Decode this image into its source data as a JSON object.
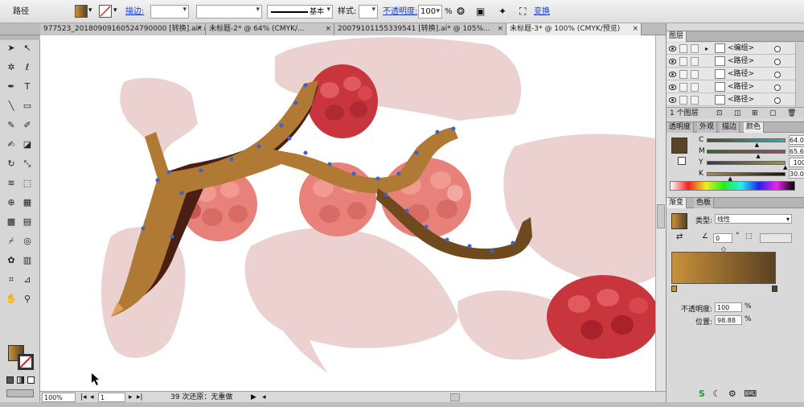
{
  "control_bar": {
    "object_type": "路径",
    "stroke_label": "描边:",
    "stroke_weight": "",
    "stroke_profile": "基本",
    "style_label": "样式:",
    "opacity_label": "不透明度:",
    "opacity_value": "100",
    "opacity_unit": "%",
    "transform_label": "变换"
  },
  "tabs": [
    {
      "label": "977523_20180909160524790000 [转换].ai* @ ..."
    },
    {
      "label": "未标题-2* @ 64% (CMYK/..."
    },
    {
      "label": "20079101155339541 [转换].ai* @ 105%..."
    },
    {
      "label": "未标题-3* @ 100% (CMYK/预览)",
      "active": true
    }
  ],
  "tools": [
    {
      "name": "selection-tool",
      "glyph": "➤"
    },
    {
      "name": "direct-selection-tool",
      "glyph": "↖"
    },
    {
      "name": "magic-wand-tool",
      "glyph": "✲"
    },
    {
      "name": "lasso-tool",
      "glyph": "ℓ"
    },
    {
      "name": "pen-tool",
      "glyph": "✒"
    },
    {
      "name": "type-tool",
      "glyph": "T"
    },
    {
      "name": "line-segment-tool",
      "glyph": "╲"
    },
    {
      "name": "rectangle-tool",
      "glyph": "▭"
    },
    {
      "name": "paintbrush-tool",
      "glyph": "✎"
    },
    {
      "name": "pencil-tool",
      "glyph": "✐"
    },
    {
      "name": "blob-brush-tool",
      "glyph": "✍"
    },
    {
      "name": "eraser-tool",
      "glyph": "◪"
    },
    {
      "name": "rotate-tool",
      "glyph": "↻"
    },
    {
      "name": "scale-tool",
      "glyph": "⤡"
    },
    {
      "name": "warp-tool",
      "glyph": "≋"
    },
    {
      "name": "free-transform-tool",
      "glyph": "⬚"
    },
    {
      "name": "shape-builder-tool",
      "glyph": "⊕"
    },
    {
      "name": "perspective-grid-tool",
      "glyph": "▦"
    },
    {
      "name": "mesh-tool",
      "glyph": "▩"
    },
    {
      "name": "gradient-tool",
      "glyph": "▤"
    },
    {
      "name": "eyedropper-tool",
      "glyph": "⌿"
    },
    {
      "name": "blend-tool",
      "glyph": "◎"
    },
    {
      "name": "symbol-sprayer-tool",
      "glyph": "✿"
    },
    {
      "name": "column-graph-tool",
      "glyph": "▥"
    },
    {
      "name": "artboard-tool",
      "glyph": "⌗"
    },
    {
      "name": "slice-tool",
      "glyph": "⊿"
    },
    {
      "name": "hand-tool",
      "glyph": "✋"
    },
    {
      "name": "zoom-tool",
      "glyph": "⚲"
    }
  ],
  "status": {
    "zoom": "100%",
    "page": "1",
    "info": "39 次还原：无重做"
  },
  "layers_panel": {
    "title": "图层",
    "rows": [
      {
        "name": "<编组>"
      },
      {
        "name": "<路径>"
      },
      {
        "name": "<路径>"
      },
      {
        "name": "<路径>"
      },
      {
        "name": "<路径>"
      }
    ],
    "footer": "1 个图层"
  },
  "color_panel": {
    "tabs": [
      "透明度",
      "外观",
      "描边",
      "颜色"
    ],
    "channels": [
      {
        "label": "C",
        "value": "64.06",
        "pct": 64.06,
        "from": "#5a4426",
        "to": "#1fb8c4"
      },
      {
        "label": "M",
        "value": "65.63",
        "pct": 65.63,
        "from": "#2f6b2a",
        "to": "#b33a6b"
      },
      {
        "label": "Y",
        "value": "100",
        "pct": 100,
        "from": "#3a2f6b",
        "to": "#a79a1d"
      },
      {
        "label": "K",
        "value": "30.08",
        "pct": 30.08,
        "from": "#b48a50",
        "to": "#1a1208"
      }
    ],
    "swatch": "#5a4426"
  },
  "gradient_panel": {
    "tabs": [
      "渐变",
      "色板"
    ],
    "type_label": "类型:",
    "type_value": "线性",
    "angle_value": "0",
    "angle_unit": "°",
    "opacity_label": "不透明度:",
    "opacity_value": "100",
    "location_label": "位置:",
    "location_value": "98.88",
    "pct_unit": "%",
    "start_color": "#c8913c",
    "end_color": "#5b4020"
  },
  "colors": {
    "silhouette": "#ebd2d0",
    "branch_light": "#b07a35",
    "branch_dark": "#6e4a1e",
    "shadow": "#4a1e12",
    "berry_red": "#c8353d",
    "berry_pink": "#e8817a",
    "anchor_blue": "#3a62d0"
  }
}
